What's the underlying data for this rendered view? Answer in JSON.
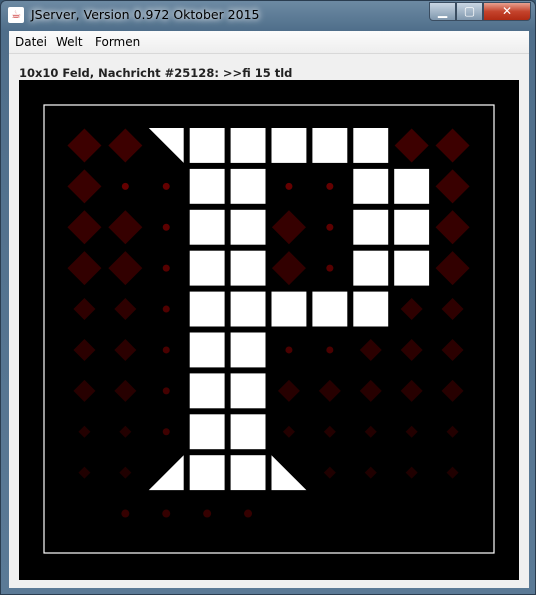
{
  "window": {
    "title": "JServer, Version 0.972 Oktober 2015",
    "icon": "java-icon",
    "controls": {
      "minimize": "minimize-icon",
      "maximize": "maximize-icon",
      "close": "close-icon"
    }
  },
  "menubar": {
    "items": [
      {
        "label": "Datei"
      },
      {
        "label": "Welt"
      },
      {
        "label": "Formen"
      }
    ]
  },
  "status": {
    "text": "10x10 Feld, Nachricht #25128: >>fi 15 tld"
  },
  "board": {
    "cols": 10,
    "rows": 10,
    "background": "#000000",
    "frame_color": "#ffffff",
    "white_color": "#ffffff",
    "red_color": "#3d0000",
    "dot_color": "#6a0000",
    "cells": [
      [
        "D",
        "D",
        "TL",
        "W",
        "W",
        "W",
        "W",
        "W",
        "D",
        "D"
      ],
      [
        "D",
        "o",
        "o",
        "W",
        "W",
        "o",
        "o",
        "W",
        "W",
        "D"
      ],
      [
        "D",
        "D",
        "o",
        "W",
        "W",
        "D",
        "o",
        "W",
        "W",
        "D"
      ],
      [
        "D",
        "D",
        "o",
        "W",
        "W",
        "D",
        "o",
        "W",
        "W",
        "D"
      ],
      [
        "d",
        "d",
        "o",
        "W",
        "W",
        "W",
        "W",
        "W",
        "d",
        "d"
      ],
      [
        "d",
        "d",
        "o",
        "W",
        "W",
        "o",
        "o",
        "d",
        "d",
        "d"
      ],
      [
        "d",
        "d",
        "o",
        "W",
        "W",
        "d",
        "d",
        "d",
        "d",
        "d"
      ],
      [
        "s",
        "s",
        "o",
        "W",
        "W",
        "s",
        "s",
        "s",
        "s",
        "s"
      ],
      [
        "s",
        "s",
        "BR",
        "W",
        "W",
        "BL",
        "s",
        "s",
        "s",
        "s"
      ],
      [
        "",
        "o",
        "o",
        "o",
        "o",
        "",
        "",
        "",
        "",
        ""
      ]
    ]
  }
}
